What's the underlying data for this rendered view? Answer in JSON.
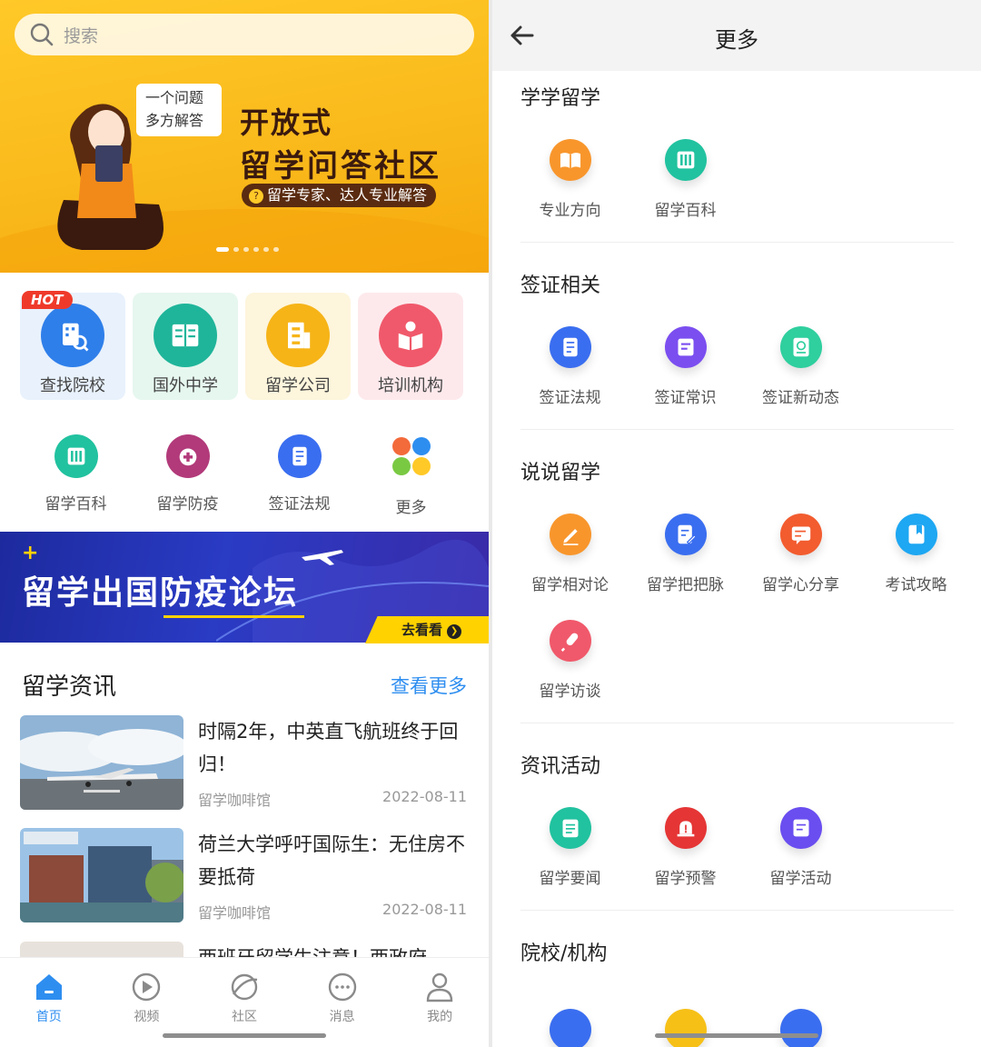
{
  "left": {
    "search": {
      "placeholder": "搜索"
    },
    "banner": {
      "bubble_line1": "一个问题",
      "bubble_line2": "多方解答",
      "title_line1": "开放式",
      "title_line2": "留学问答社区",
      "pill_text": "留学专家、达人专业解答",
      "pill_icon": "?",
      "slide_count": 6,
      "active_slide": 1
    },
    "categories": [
      {
        "label": "查找院校",
        "badge": "HOT",
        "icon": "school-search-icon",
        "bg": "#e8f1fc",
        "color": "#2f7fea"
      },
      {
        "label": "国外中学",
        "icon": "book-icon",
        "bg": "#e6f7ef",
        "color": "#1fb59a"
      },
      {
        "label": "留学公司",
        "icon": "building-icon",
        "bg": "#fdf5dc",
        "color": "#f6b417"
      },
      {
        "label": "培训机构",
        "icon": "training-icon",
        "bg": "#fde9ec",
        "color": "#f0596b"
      }
    ],
    "quick_links": [
      {
        "label": "留学百科",
        "icon": "encyclopedia-icon",
        "color": "#21c29f"
      },
      {
        "label": "留学防疫",
        "icon": "epidemic-icon",
        "color": "#b23a7a"
      },
      {
        "label": "签证法规",
        "icon": "visa-law-icon",
        "color": "#3a6ef0"
      },
      {
        "label": "更多",
        "icon": "more-icon",
        "color": "#f36a3b"
      }
    ],
    "forum_banner": {
      "title": "留学出国防疫论坛",
      "button": "去看看",
      "plus": "+"
    },
    "news": {
      "heading": "留学资讯",
      "more_link": "查看更多",
      "items": [
        {
          "title": "时隔2年，中英直飞航班终于回归！",
          "source": "留学咖啡馆",
          "date": "2022-08-11"
        },
        {
          "title": "荷兰大学呼吁国际生：无住房不要抵荷",
          "source": "留学咖啡馆",
          "date": "2022-08-11"
        },
        {
          "title": "西班牙留学生注意！西政府",
          "source": "",
          "date": ""
        }
      ]
    },
    "tabs": [
      {
        "label": "首页",
        "icon": "home-icon",
        "active": true
      },
      {
        "label": "视频",
        "icon": "video-icon",
        "active": false
      },
      {
        "label": "社区",
        "icon": "community-icon",
        "active": false
      },
      {
        "label": "消息",
        "icon": "message-icon",
        "active": false
      },
      {
        "label": "我的",
        "icon": "profile-icon",
        "active": false
      }
    ]
  },
  "right": {
    "title": "更多",
    "sections": [
      {
        "title": "学学留学",
        "items": [
          {
            "label": "专业方向",
            "icon": "book-open-icon",
            "color": "#f8962c"
          },
          {
            "label": "留学百科",
            "icon": "encyclopedia-icon",
            "color": "#21c29f"
          }
        ]
      },
      {
        "title": "签证相关",
        "items": [
          {
            "label": "签证法规",
            "icon": "visa-law-icon",
            "color": "#3a6ef0"
          },
          {
            "label": "签证常识",
            "icon": "visa-doc-icon",
            "color": "#7b4ef0"
          },
          {
            "label": "签证新动态",
            "icon": "visa-news-icon",
            "color": "#2fcf9e"
          }
        ]
      },
      {
        "title": "说说留学",
        "items": [
          {
            "label": "留学相对论",
            "icon": "pencil-icon",
            "color": "#f8962c"
          },
          {
            "label": "留学把把脉",
            "icon": "edit-doc-icon",
            "color": "#3a6ef0"
          },
          {
            "label": "留学心分享",
            "icon": "chat-card-icon",
            "color": "#f25c2f"
          },
          {
            "label": "考试攻略",
            "icon": "bookmark-icon",
            "color": "#1ea7f2"
          },
          {
            "label": "留学访谈",
            "icon": "microphone-icon",
            "color": "#f0596b"
          }
        ]
      },
      {
        "title": "资讯活动",
        "items": [
          {
            "label": "留学要闻",
            "icon": "notepad-icon",
            "color": "#21c29f"
          },
          {
            "label": "留学预警",
            "icon": "alarm-icon",
            "color": "#e53535"
          },
          {
            "label": "留学活动",
            "icon": "activity-icon",
            "color": "#6a4ef0"
          }
        ]
      },
      {
        "title": "院校/机构",
        "items": []
      }
    ]
  }
}
